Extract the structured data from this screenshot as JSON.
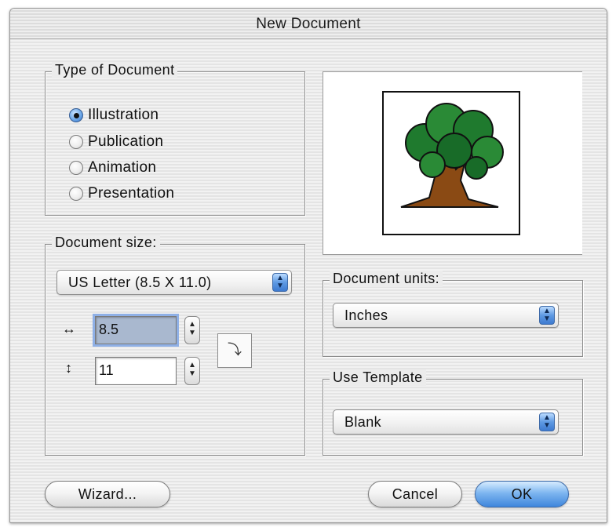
{
  "window": {
    "title": "New Document"
  },
  "doc_type": {
    "legend": "Type of Document",
    "options": [
      {
        "label": "Illustration",
        "selected": true
      },
      {
        "label": "Publication",
        "selected": false
      },
      {
        "label": "Animation",
        "selected": false
      },
      {
        "label": "Presentation",
        "selected": false
      }
    ]
  },
  "doc_size": {
    "legend": "Document size:",
    "preset": "US Letter (8.5 X 11.0)",
    "width_value": "8.5",
    "height_value": "11",
    "width_icon": "horizontal-arrows-icon",
    "height_icon": "vertical-arrows-icon",
    "orientation_icon": "orientation-swap-icon"
  },
  "doc_units": {
    "legend": "Document units:",
    "value": "Inches"
  },
  "template": {
    "legend": "Use Template",
    "value": "Blank"
  },
  "preview": {
    "image": "tree-clipart"
  },
  "buttons": {
    "wizard": "Wizard...",
    "cancel": "Cancel",
    "ok": "OK"
  },
  "colors": {
    "accent": "#4a8fe0",
    "leaf": "#1f7a2e",
    "trunk": "#8a4a14"
  }
}
